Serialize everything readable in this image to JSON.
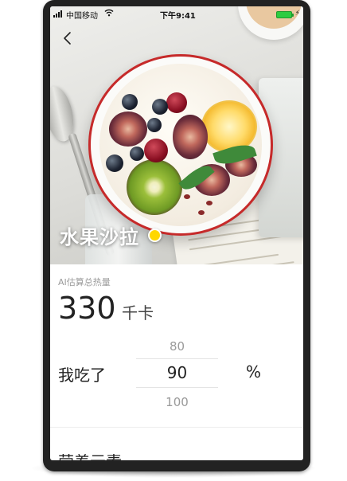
{
  "status_bar": {
    "carrier": "中国移动",
    "time": "下午9:41"
  },
  "nav": {
    "back_icon": "chevron-left-icon"
  },
  "hero": {
    "dish_name": "水果沙拉"
  },
  "calories": {
    "label": "AI估算总热量",
    "value": "330",
    "unit": "千卡"
  },
  "portion": {
    "label": "我吃了",
    "options": [
      "80",
      "90",
      "100"
    ],
    "selected": "90",
    "unit": "%"
  },
  "nutrition": {
    "heading": "营养元素"
  },
  "colors": {
    "accent_dot": "#ffd700",
    "battery": "#2ecc40",
    "frame": "#222222"
  }
}
